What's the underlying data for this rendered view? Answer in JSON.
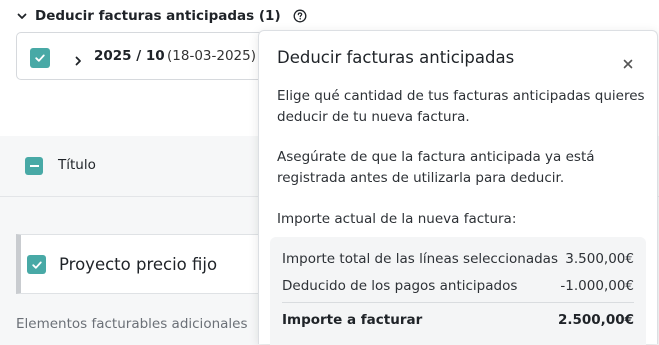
{
  "section": {
    "title": "Deducir facturas anticipadas (1)",
    "help_icon": "question-circle-icon",
    "toggle_icon": "chevron-down-icon"
  },
  "advance_invoice": {
    "checked": true,
    "period": "2025 / 10",
    "date": "(18-03-2025)"
  },
  "table": {
    "select_all_state": "indeterminate",
    "column_title": "Título"
  },
  "project": {
    "checked": true,
    "name": "Proyecto precio fijo"
  },
  "additional_items_label": "Elementos facturables adicionales",
  "popover": {
    "title": "Deducir facturas anticipadas",
    "paragraph1": "Elige qué cantidad de tus facturas anticipadas quieres deducir de tu nueva factura.",
    "paragraph2": "Asegúrate de que la factura anticipada ya está registrada antes de utilizarla para deducir.",
    "paragraph3": "Importe actual de la nueva factura:",
    "rows": [
      {
        "label": "Importe total de las líneas seleccionadas",
        "value": "3.500,00€"
      },
      {
        "label": "Deducido de los pagos anticipados",
        "value": "-1.000,00€"
      },
      {
        "label": "Importe a facturar",
        "value": "2.500,00€"
      }
    ]
  },
  "colors": {
    "accent": "#48a9a6",
    "band": "#f6f7f8"
  }
}
